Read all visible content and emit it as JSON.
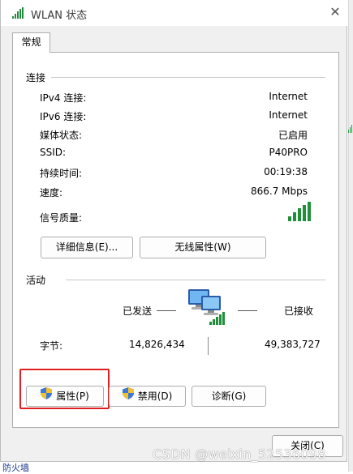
{
  "window": {
    "title": "WLAN 状态",
    "close_glyph": "✕"
  },
  "tabs": [
    {
      "label": "常规"
    }
  ],
  "connection": {
    "section_label": "连接",
    "rows": [
      {
        "label": "IPv4 连接:",
        "value": "Internet"
      },
      {
        "label": "IPv6 连接:",
        "value": "Internet"
      },
      {
        "label": "媒体状态:",
        "value": "已启用"
      },
      {
        "label": "SSID:",
        "value": "P40PRO"
      },
      {
        "label": "持续时间:",
        "value": "00:19:38"
      },
      {
        "label": "速度:",
        "value": "866.7 Mbps"
      }
    ],
    "signal_label": "信号质量:",
    "signal_icon": "signal-bars-icon",
    "details_button": "详细信息(E)...",
    "wireless_props_button": "无线属性(W)"
  },
  "activity": {
    "section_label": "活动",
    "sent_label": "已发送",
    "received_label": "已接收",
    "bytes_label": "字节:",
    "bytes_sent": "14,826,434",
    "bytes_received": "49,383,727",
    "network_icon": "network-computers-icon"
  },
  "actions": {
    "properties_button": "属性(P)",
    "disable_button": "禁用(D)",
    "diagnose_button": "诊断(G)",
    "shield_icon": "uac-shield-icon"
  },
  "footer": {
    "close_button": "关闭(C)",
    "watermark": "CSDN @weixin_52536098",
    "background_fragment": "防火墙"
  },
  "colors": {
    "signal_green": "#1f8f3a",
    "highlight_red": "#e02020",
    "dialog_bg": "#f0f0f0",
    "panel_bg": "#ffffff"
  }
}
